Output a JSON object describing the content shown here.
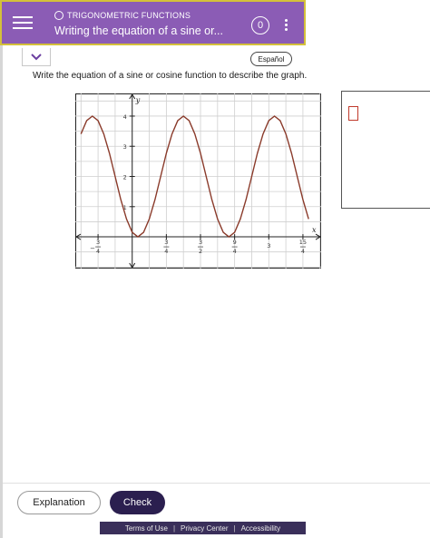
{
  "header": {
    "topic": "TRIGONOMETRIC FUNCTIONS",
    "title": "Writing the equation of a sine or...",
    "badge": "0"
  },
  "language_button": "Español",
  "instruction": "Write the equation of a sine or cosine function to describe the graph.",
  "chart_data": {
    "type": "line",
    "xlabel": "x",
    "ylabel": "y",
    "x_ticks": [
      {
        "num": "3",
        "den": "4",
        "sign": "−",
        "value": -0.75
      },
      {
        "num": "3",
        "den": "4",
        "sign": "",
        "value": 0.75
      },
      {
        "num": "3",
        "den": "2",
        "sign": "",
        "value": 1.5
      },
      {
        "num": "9",
        "den": "4",
        "sign": "",
        "value": 2.25
      },
      {
        "num": "3",
        "den": "",
        "sign": "",
        "value": 3
      },
      {
        "num": "15",
        "den": "4",
        "sign": "",
        "value": 3.75
      }
    ],
    "y_ticks": [
      "1",
      "2",
      "3",
      "4"
    ],
    "xlim": [
      -1.25,
      4.15
    ],
    "ylim": [
      -1.05,
      4.75
    ],
    "series": [
      {
        "x": [
          -1.125,
          -1.0,
          -0.875,
          -0.75,
          -0.625,
          -0.5,
          -0.375,
          -0.25,
          -0.125,
          0,
          0.125,
          0.25,
          0.375,
          0.5,
          0.625,
          0.75,
          0.875,
          1.0,
          1.125,
          1.25,
          1.375,
          1.5,
          1.625,
          1.75,
          1.875,
          2.0,
          2.125,
          2.25,
          2.375,
          2.5,
          2.625,
          2.75,
          2.875,
          3.0,
          3.125,
          3.25,
          3.375,
          3.5,
          3.625,
          3.75,
          3.875
        ],
        "y": [
          3.41,
          3.85,
          4.0,
          3.85,
          3.41,
          2.77,
          2.0,
          1.23,
          0.59,
          0.15,
          0.0,
          0.15,
          0.59,
          1.23,
          2.0,
          2.77,
          3.41,
          3.85,
          4.0,
          3.85,
          3.41,
          2.77,
          2.0,
          1.23,
          0.59,
          0.15,
          0.0,
          0.15,
          0.59,
          1.23,
          2.0,
          2.77,
          3.41,
          3.85,
          4.0,
          3.85,
          3.41,
          2.77,
          2.0,
          1.23,
          0.59
        ]
      }
    ],
    "colors": {
      "curve": "#8a3a2a",
      "grid": "#cfcfcf",
      "axis": "#222222"
    },
    "grid": true
  },
  "buttons": {
    "explanation": "Explanation",
    "check": "Check"
  },
  "footer": {
    "terms": "Terms of Use",
    "privacy": "Privacy Center",
    "accessibility": "Accessibility",
    "separator": "|"
  }
}
